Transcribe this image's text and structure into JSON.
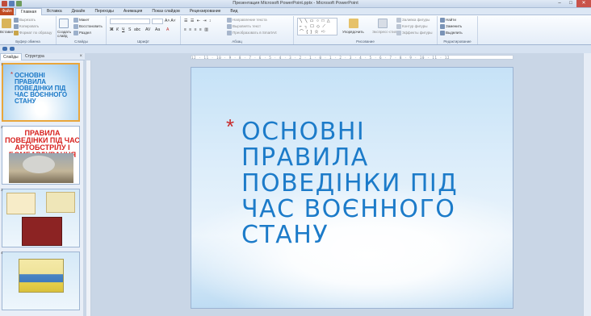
{
  "window": {
    "title": "Презентация Microsoft PowerPoint.pptx - Microsoft PowerPoint"
  },
  "tabs": [
    "Файл",
    "Главная",
    "Вставка",
    "Дизайн",
    "Переходы",
    "Анимация",
    "Показ слайдов",
    "Рецензирование",
    "Вид"
  ],
  "active_tab": "Главная",
  "ribbon": {
    "clipboard": {
      "label": "Буфер обмена",
      "paste": "Вставить",
      "cut": "Вырезать",
      "copy": "Копировать",
      "format_painter": "Формат по образцу"
    },
    "slides": {
      "label": "Слайды",
      "new_slide": "Создать слайд",
      "layout": "Макет",
      "reset": "Восстановить",
      "section": "Раздел"
    },
    "font": {
      "label": "Шрифт"
    },
    "paragraph": {
      "label": "Абзац",
      "text_direction": "Направление текста",
      "align_text": "Выровнять текст",
      "smartart": "Преобразовать в SmartArt"
    },
    "drawing": {
      "label": "Рисование",
      "arrange": "Упорядочить",
      "quick_styles": "Экспресс-стили",
      "shape_fill": "Заливка фигуры",
      "shape_outline": "Контур фигуры",
      "shape_effects": "Эффекты фигуры"
    },
    "editing": {
      "label": "Редактирование",
      "find": "Найти",
      "replace": "Заменить",
      "select": "Выделить"
    }
  },
  "panel": {
    "tab_slides": "Слайды",
    "tab_outline": "Структура",
    "thumbs": [
      {
        "num": "1",
        "title": "Основні правила поведінки під час воєнного стану"
      },
      {
        "num": "2",
        "title": "ПРАВИЛА ПОВЕДІНКИ ПІД ЧАС АРТОБСТРІЛУ І БОМБАРДУВАННЯ"
      },
      {
        "num": "3"
      },
      {
        "num": "4"
      }
    ]
  },
  "ruler": {
    "marks": "12 · 11 · 10 · 9 · 8 · 7 · 6 · 5 · 4 · 3 · 2 · 1 · 0 · 1 · 2 · 3 · 4 · 5 · 6 · 7 · 8 · 9 · 10 · 11 · 12"
  },
  "slide": {
    "title": "Основні правила поведінки під час воєнного стану",
    "bullet": "*"
  },
  "colors": {
    "title_blue": "#1c7bc9",
    "bullet_red": "#c72a2a",
    "file_tab": "#c04a20"
  }
}
